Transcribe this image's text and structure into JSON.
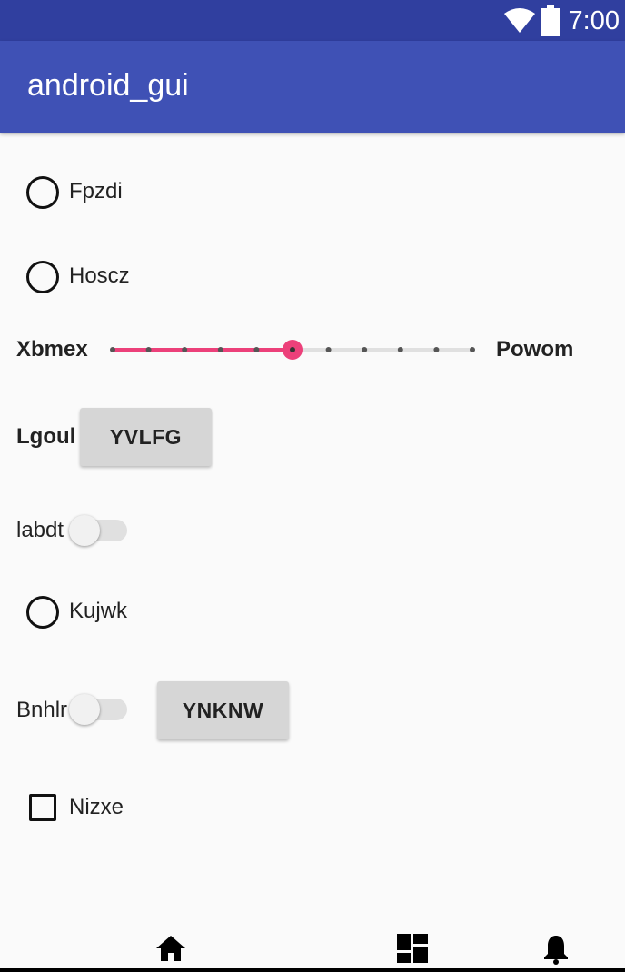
{
  "status_bar": {
    "time": "7:00",
    "icons": [
      "wifi-icon",
      "battery-icon"
    ]
  },
  "app_bar": {
    "title": "android_gui"
  },
  "radios": [
    {
      "label": "Fpzdi",
      "checked": false
    },
    {
      "label": "Hoscz",
      "checked": false
    },
    {
      "label": "Kujwk",
      "checked": false
    }
  ],
  "slider": {
    "left_label": "Xbmex",
    "right_label": "Powom",
    "value": 5,
    "min": 0,
    "max": 10,
    "accent": "#ec407a"
  },
  "lgoul_row": {
    "label": "Lgoul",
    "button": "YVLFG"
  },
  "labdt_row": {
    "label": "labdt",
    "on": false
  },
  "bnhlr_row": {
    "label": "Bnhlr",
    "on": false,
    "button": "YNKNW"
  },
  "checkbox": {
    "label": "Nizxe",
    "checked": false
  },
  "bottom_nav": {
    "icons": [
      "home-icon",
      "dashboard-icon",
      "notifications-icon"
    ]
  },
  "colors": {
    "primary": "#3f51b5",
    "primary_dark": "#303f9f",
    "accent": "#ec407a"
  }
}
